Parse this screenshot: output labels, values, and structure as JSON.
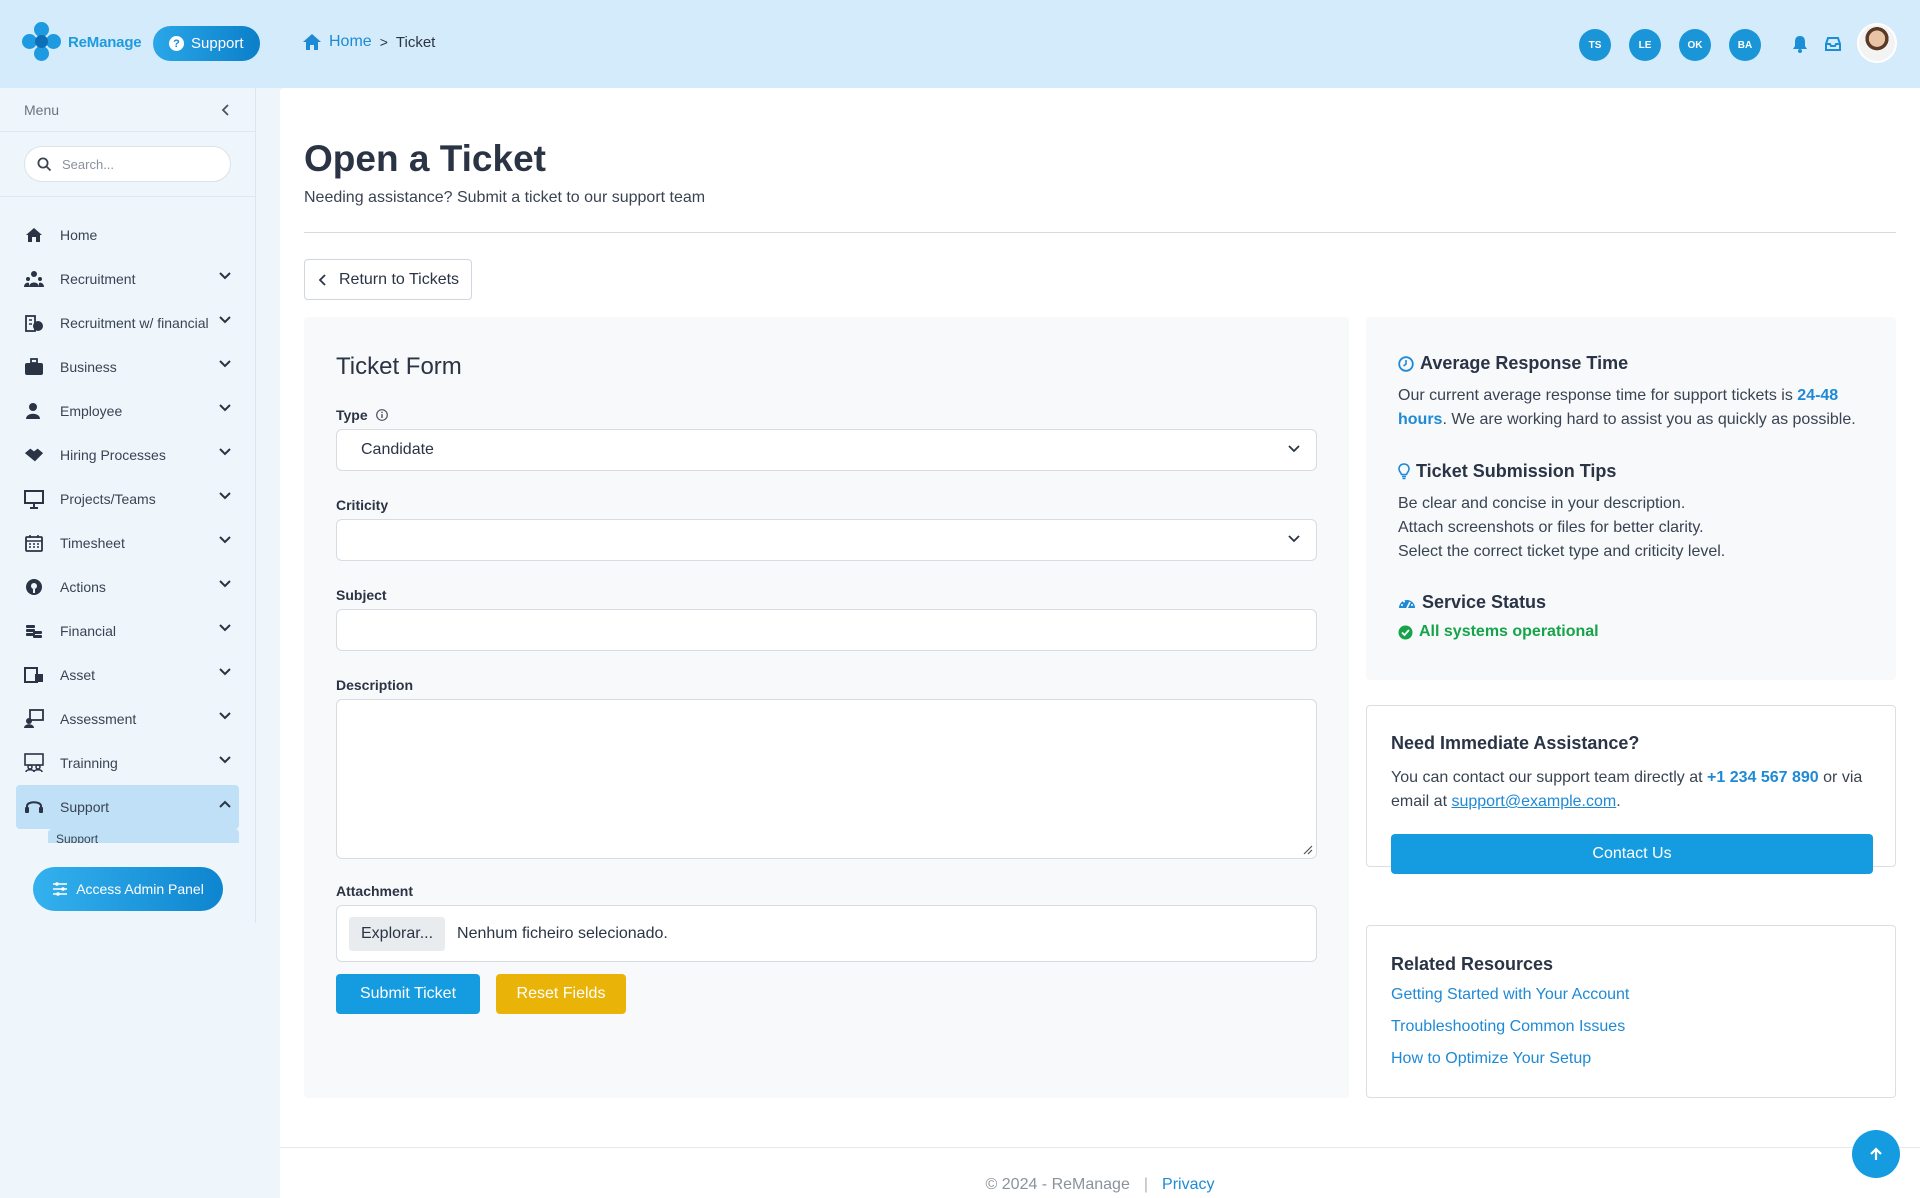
{
  "brand": {
    "name": "ReManage",
    "support_label": "Support"
  },
  "breadcrumb": {
    "home": "Home",
    "separator": ">",
    "current": "Ticket"
  },
  "header_avatars": [
    "TS",
    "LE",
    "OK",
    "BA"
  ],
  "sidebar": {
    "menu_label": "Menu",
    "search_placeholder": "Search...",
    "items": [
      {
        "label": "Home",
        "icon": "home-icon"
      },
      {
        "label": "Recruitment",
        "icon": "people-icon"
      },
      {
        "label": "Recruitment w/ financial",
        "icon": "recruit-financial-icon"
      },
      {
        "label": "Business",
        "icon": "briefcase-icon"
      },
      {
        "label": "Employee",
        "icon": "employee-icon"
      },
      {
        "label": "Hiring Processes",
        "icon": "handshake-icon"
      },
      {
        "label": "Projects/Teams",
        "icon": "presentation-icon"
      },
      {
        "label": "Timesheet",
        "icon": "calendar-icon"
      },
      {
        "label": "Actions",
        "icon": "actions-icon"
      },
      {
        "label": "Financial",
        "icon": "coins-icon"
      },
      {
        "label": "Asset",
        "icon": "asset-icon"
      },
      {
        "label": "Assessment",
        "icon": "assessment-icon"
      },
      {
        "label": "Trainning",
        "icon": "training-icon"
      },
      {
        "label": "Support",
        "icon": "headset-icon"
      }
    ],
    "sub_item": "Support",
    "admin_button": "Access Admin Panel"
  },
  "page": {
    "title": "Open a Ticket",
    "subtitle": "Needing assistance? Submit a ticket to our support team",
    "return_button": "Return to Tickets"
  },
  "form": {
    "title": "Ticket Form",
    "type_label": "Type",
    "type_value": "Candidate",
    "criticity_label": "Criticity",
    "criticity_value": "",
    "subject_label": "Subject",
    "description_label": "Description",
    "attachment_label": "Attachment",
    "file_button": "Explorar...",
    "file_status": "Nenhum ficheiro selecionado.",
    "submit": "Submit Ticket",
    "reset": "Reset Fields"
  },
  "info": {
    "response_title": "Average Response Time",
    "response_text_a": "Our current average response time for support tickets is ",
    "response_highlight": "24-48 hours",
    "response_text_b": ". We are working hard to assist you as quickly as possible.",
    "tips_title": "Ticket Submission Tips",
    "tips": [
      "Be clear and concise in your description.",
      "Attach screenshots or files for better clarity.",
      "Select the correct ticket type and criticity level."
    ],
    "status_title": "Service Status",
    "status_text": "All systems operational"
  },
  "assist": {
    "title": "Need Immediate Assistance?",
    "text_a": "You can contact our support team directly at ",
    "phone": "+1 234 567 890",
    "text_b": " or via email at ",
    "email": "support@example.com",
    "text_c": ".",
    "button": "Contact Us"
  },
  "resources": {
    "title": "Related Resources",
    "links": [
      "Getting Started with Your Account",
      "Troubleshooting Common Issues",
      "How to Optimize Your Setup"
    ]
  },
  "footer": {
    "copyright": "© 2024 - ReManage",
    "divider": "|",
    "privacy": "Privacy"
  },
  "colors": {
    "accent": "#149be0",
    "header_bg": "#d3ebfa",
    "reset": "#eab308",
    "success": "#17a34a"
  }
}
